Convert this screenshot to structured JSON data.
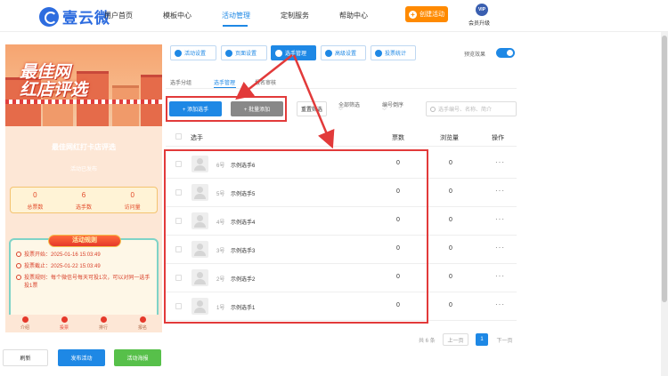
{
  "header": {
    "logo_text": "壹云微",
    "nav": [
      {
        "label": "用户首页"
      },
      {
        "label": "模板中心"
      },
      {
        "label": "活动管理"
      },
      {
        "label": "定制服务"
      },
      {
        "label": "帮助中心"
      }
    ],
    "create_button": "创建活动",
    "vip_badge": "VIP",
    "vip_label": "会员升级"
  },
  "preview": {
    "banner_line1": "最佳网",
    "banner_line2": "红店评选",
    "title": "最佳网红打卡店评选",
    "subtitle": "活动已发布",
    "stats": [
      {
        "value": "0",
        "label": "总票数"
      },
      {
        "value": "6",
        "label": "选手数"
      },
      {
        "value": "0",
        "label": "访问量"
      }
    ],
    "rules_title": "活动规则",
    "rules": [
      "投票开始：2025-01-16 15:03:49",
      "投票截止：2025-01-22 15:03:49",
      "投票规则：每个微信号每天可投1次，可以对同一选手投1票"
    ],
    "tabs": [
      "介绍",
      "投票",
      "排行",
      "报名"
    ]
  },
  "bottom_buttons": {
    "refresh": "刷新",
    "publish": "发布活动",
    "poster": "活动海报"
  },
  "toolbar": {
    "buttons": [
      "活动设置",
      "页面设置",
      "选手管理",
      "高级设置",
      "投票统计"
    ],
    "preview_label": "预览效果"
  },
  "subtabs": [
    "选手分组",
    "选手管理",
    "报名审核"
  ],
  "actions": {
    "add": "+ 添加选手",
    "batch": "+ 批量添加",
    "reset": "重置筛选",
    "filter_all": "全部筛选",
    "sort": "编号倒序",
    "search_placeholder": "选手编号、名称、简介"
  },
  "table": {
    "headers": {
      "player": "选手",
      "votes": "票数",
      "views": "浏览量",
      "ops": "操作"
    },
    "rows": [
      {
        "num": "6号",
        "name": "示例选手6",
        "votes": "0",
        "views": "0"
      },
      {
        "num": "5号",
        "name": "示例选手5",
        "votes": "0",
        "views": "0"
      },
      {
        "num": "4号",
        "name": "示例选手4",
        "votes": "0",
        "views": "0"
      },
      {
        "num": "3号",
        "name": "示例选手3",
        "votes": "0",
        "views": "0"
      },
      {
        "num": "2号",
        "name": "示例选手2",
        "votes": "0",
        "views": "0"
      },
      {
        "num": "1号",
        "name": "示例选手1",
        "votes": "0",
        "views": "0"
      }
    ],
    "more_label": "···"
  },
  "pagination": {
    "total": "共 6 条",
    "prev": "上一页",
    "current": "1",
    "next": "下一页"
  },
  "colors": {
    "primary": "#1e88e5",
    "accent_orange": "#ff8a00",
    "highlight_red": "#e23a3a",
    "success_green": "#57c04a"
  }
}
